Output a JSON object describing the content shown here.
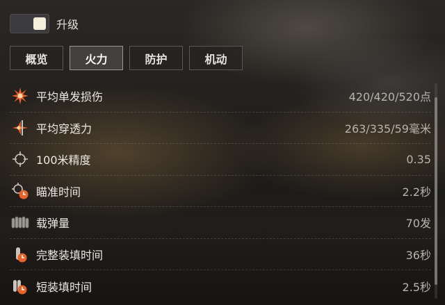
{
  "upgrade_toggle": {
    "label": "升级",
    "state": "on"
  },
  "tabs": [
    {
      "label": "概览",
      "active": false
    },
    {
      "label": "火力",
      "active": true
    },
    {
      "label": "防护",
      "active": false
    },
    {
      "label": "机动",
      "active": false
    }
  ],
  "stats": [
    {
      "icon": "damage-burst-icon",
      "label": "平均单发损伤",
      "value": "420/420/520点"
    },
    {
      "icon": "penetration-icon",
      "label": "平均穿透力",
      "value": "263/335/59毫米"
    },
    {
      "icon": "crosshair-icon",
      "label": "100米精度",
      "value": "0.35"
    },
    {
      "icon": "aim-timer-icon",
      "label": "瞄准时间",
      "value": "2.2秒"
    },
    {
      "icon": "ammo-rack-icon",
      "label": "载弹量",
      "value": "70发"
    },
    {
      "icon": "shell-reload-icon",
      "label": "完整装填时间",
      "value": "36秒"
    },
    {
      "icon": "short-reload-icon",
      "label": "短装填时间",
      "value": "2.5秒"
    }
  ],
  "colors": {
    "accent_orange": "#e8622a",
    "text": "#ece8e2",
    "value_text": "#b8b3ac"
  }
}
